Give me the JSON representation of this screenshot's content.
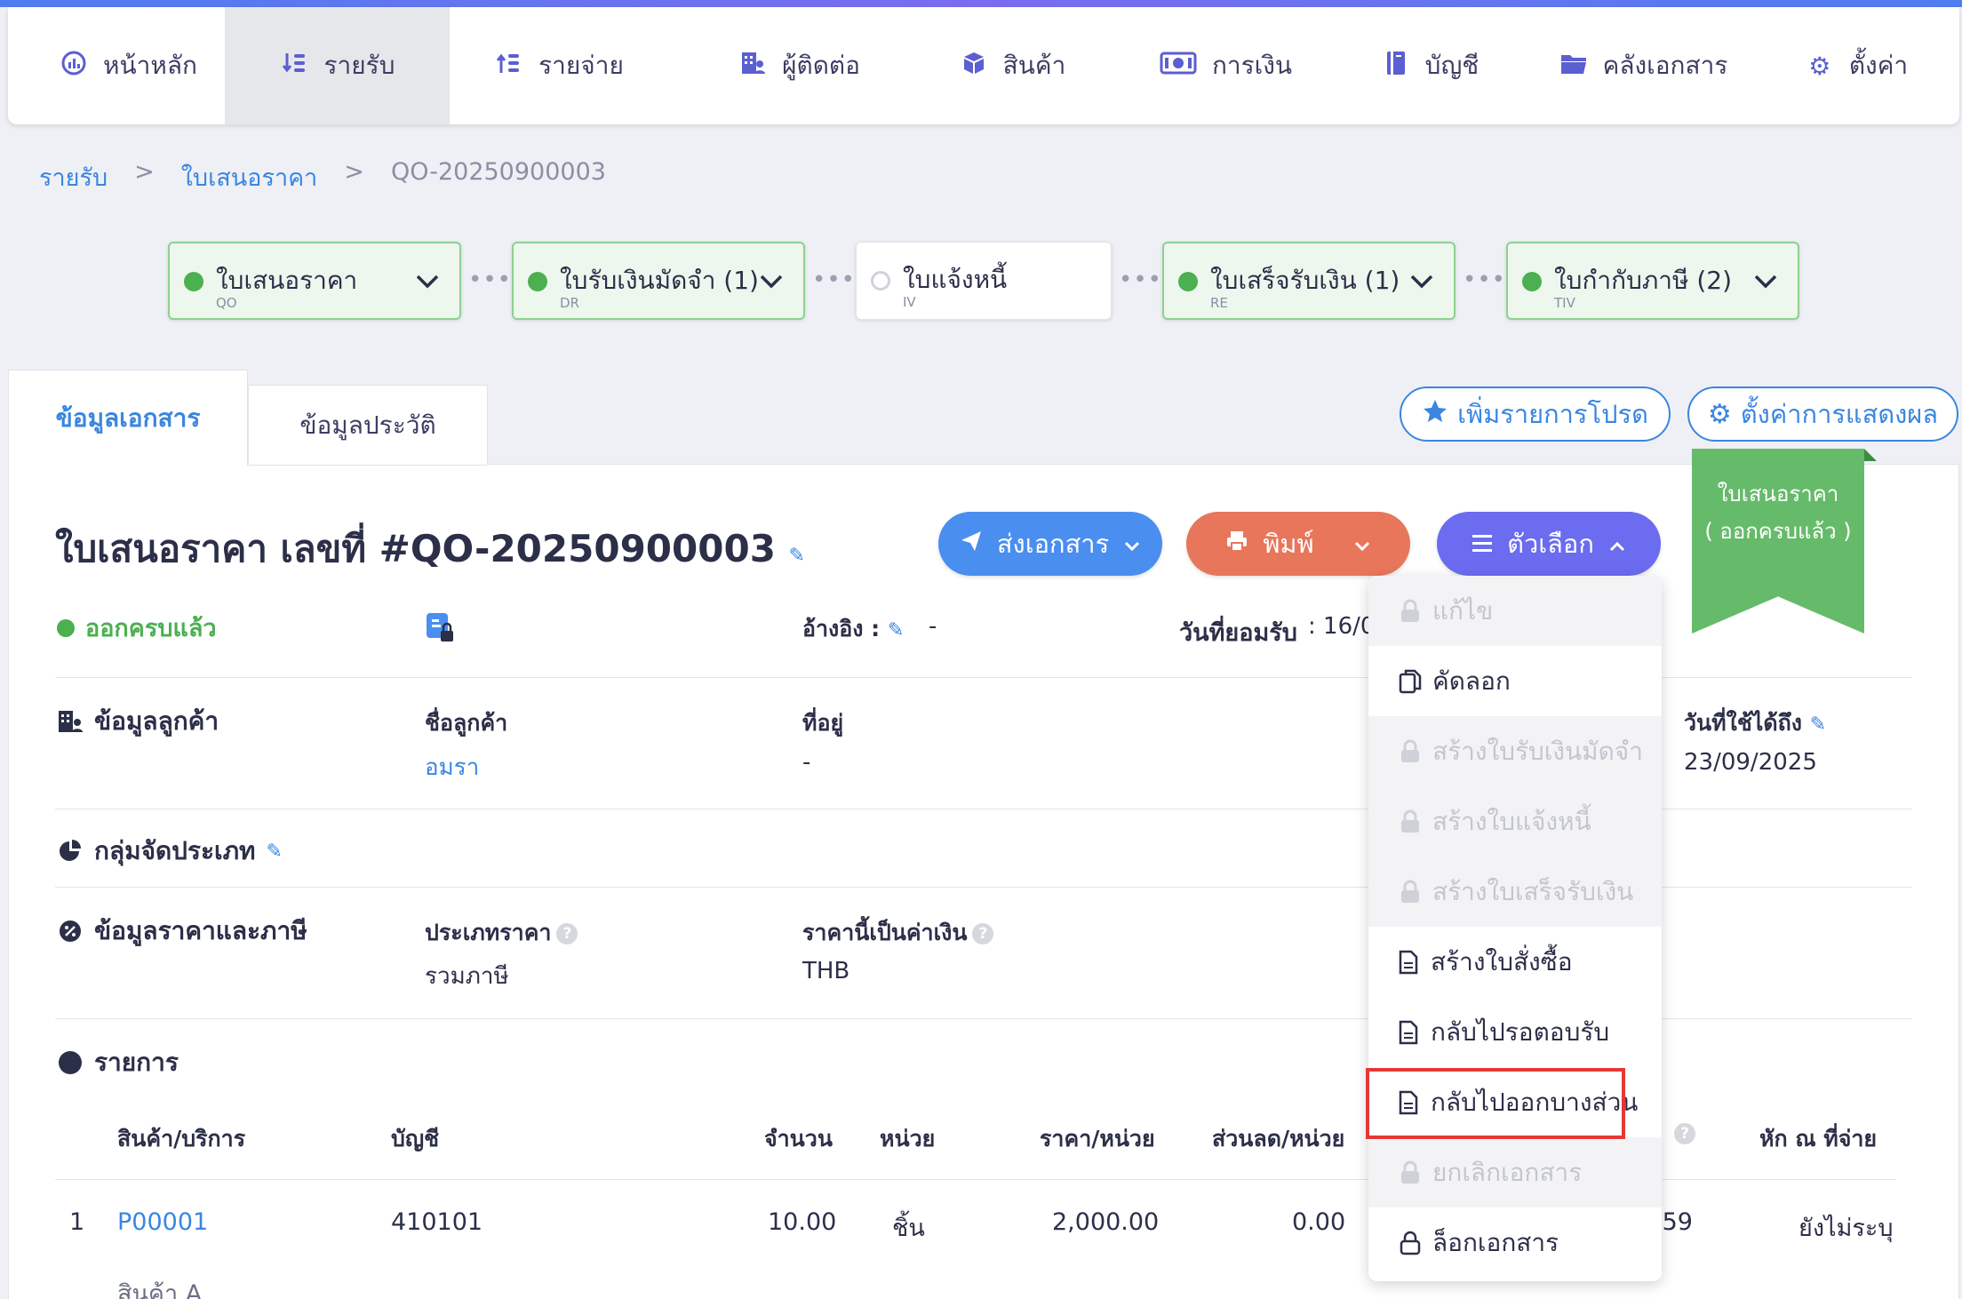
{
  "nav": {
    "items": [
      {
        "label": "หน้าหลัก",
        "icon": "dashboard-icon",
        "glyph": "◉"
      },
      {
        "label": "รายรับ",
        "icon": "income-icon",
        "glyph": "⇊"
      },
      {
        "label": "รายจ่าย",
        "icon": "expense-icon",
        "glyph": "⇈"
      },
      {
        "label": "ผู้ติดต่อ",
        "icon": "contacts-icon",
        "glyph": "▦"
      },
      {
        "label": "สินค้า",
        "icon": "product-box-icon",
        "glyph": "⬢"
      },
      {
        "label": "การเงิน",
        "icon": "money-icon",
        "glyph": "▣"
      },
      {
        "label": "บัญชี",
        "icon": "ledger-icon",
        "glyph": "▥"
      },
      {
        "label": "คลังเอกสาร",
        "icon": "folder-icon",
        "glyph": "▰"
      },
      {
        "label": "ตั้งค่า",
        "icon": "gear-icon",
        "glyph": "⚙"
      }
    ],
    "active_index": 1
  },
  "breadcrumb": {
    "level1": "รายรับ",
    "level2": "ใบเสนอราคา",
    "sep": ">",
    "current": "QO-20250900003"
  },
  "flow": [
    {
      "label": "ใบเสนอราคา",
      "code": "QO",
      "status": "done"
    },
    {
      "label": "ใบรับเงินมัดจำ (1)",
      "code": "DR",
      "status": "done"
    },
    {
      "label": "ใบแจ้งหนี้",
      "code": "IV",
      "status": "pending"
    },
    {
      "label": "ใบเสร็จรับเงิน (1)",
      "code": "RE",
      "status": "done"
    },
    {
      "label": "ใบกำกับภาษี (2)",
      "code": "TIV",
      "status": "done"
    }
  ],
  "flow_separator": "•••",
  "tabs": {
    "doc_info": "ข้อมูลเอกสาร",
    "history": "ข้อมูลประวัติ"
  },
  "top_buttons": {
    "favorite": "เพิ่มรายการโปรด",
    "display_settings": "ตั้งค่าการแสดงผล"
  },
  "document": {
    "title": "ใบเสนอราคา เลขที่ #QO-20250900003",
    "status": "ออกครบแล้ว",
    "ribbon_line1": "ใบเสนอราคา",
    "ribbon_line2": "( ออกครบแล้ว )",
    "reference_label": "อ้างอิง :",
    "reference_value": "-",
    "accepted_date_label": "วันที่ยอมรับ",
    "accepted_date_value": ": 16/0"
  },
  "actions": {
    "send": "ส่งเอกสาร",
    "print": "พิมพ์",
    "options": "ตัวเลือก"
  },
  "colors": {
    "send": "#4a8ef0",
    "print": "#e8765b",
    "options": "#6b6cf0",
    "status_green": "#4caf50",
    "highlight": "#e53935"
  },
  "customer_section": {
    "title": "ข้อมูลลูกค้า",
    "name_label": "ชื่อลูกค้า",
    "name_value": "อมรา",
    "address_label": "ที่อยู่",
    "address_value": "-",
    "valid_until_label": "วันที่ใช้ได้ถึง",
    "valid_until_value": "23/09/2025"
  },
  "category_section": {
    "title": "กลุ่มจัดประเภท"
  },
  "pricing_section": {
    "title": "ข้อมูลราคาและภาษี",
    "price_type_label": "ประเภทราคา",
    "price_type_value": "รวมภาษี",
    "currency_label": "ราคานี้เป็นค่าเงิน",
    "currency_value": "THB"
  },
  "items_section": {
    "title": "รายการ",
    "headers": {
      "product": "สินค้า/บริการ",
      "account": "บัญชี",
      "qty": "จำนวน",
      "unit": "หน่วย",
      "unit_price": "ราคา/หน่วย",
      "discount": "ส่วนลด/หน่วย",
      "withholding": "หัก ณ ที่จ่าย"
    },
    "rows": [
      {
        "no": "1",
        "code": "P00001",
        "account": "410101",
        "qty": "10.00",
        "unit": "ชิ้น",
        "unit_price": "2,000.00",
        "discount": "0.00",
        "amount_partial": ".59",
        "withholding": "ยังไม่ระบุ",
        "name": "สินค้า A"
      }
    ]
  },
  "options_menu": [
    {
      "label": "แก้ไข",
      "enabled": false,
      "icon": "lock-icon"
    },
    {
      "label": "คัดลอก",
      "enabled": true,
      "icon": "copy-icon"
    },
    {
      "label": "สร้างใบรับเงินมัดจำ",
      "enabled": false,
      "icon": "lock-icon"
    },
    {
      "label": "สร้างใบแจ้งหนี้",
      "enabled": false,
      "icon": "lock-icon"
    },
    {
      "label": "สร้างใบเสร็จรับเงิน",
      "enabled": false,
      "icon": "lock-icon"
    },
    {
      "label": "สร้างใบสั่งซื้อ",
      "enabled": true,
      "icon": "document-icon"
    },
    {
      "label": "กลับไปรอตอบรับ",
      "enabled": true,
      "icon": "document-icon"
    },
    {
      "label": "กลับไปออกบางส่วน",
      "enabled": true,
      "icon": "document-icon",
      "highlighted": true
    },
    {
      "label": "ยกเลิกเอกสาร",
      "enabled": false,
      "icon": "lock-icon"
    },
    {
      "label": "ล็อกเอกสาร",
      "enabled": true,
      "icon": "unlock-icon"
    }
  ]
}
